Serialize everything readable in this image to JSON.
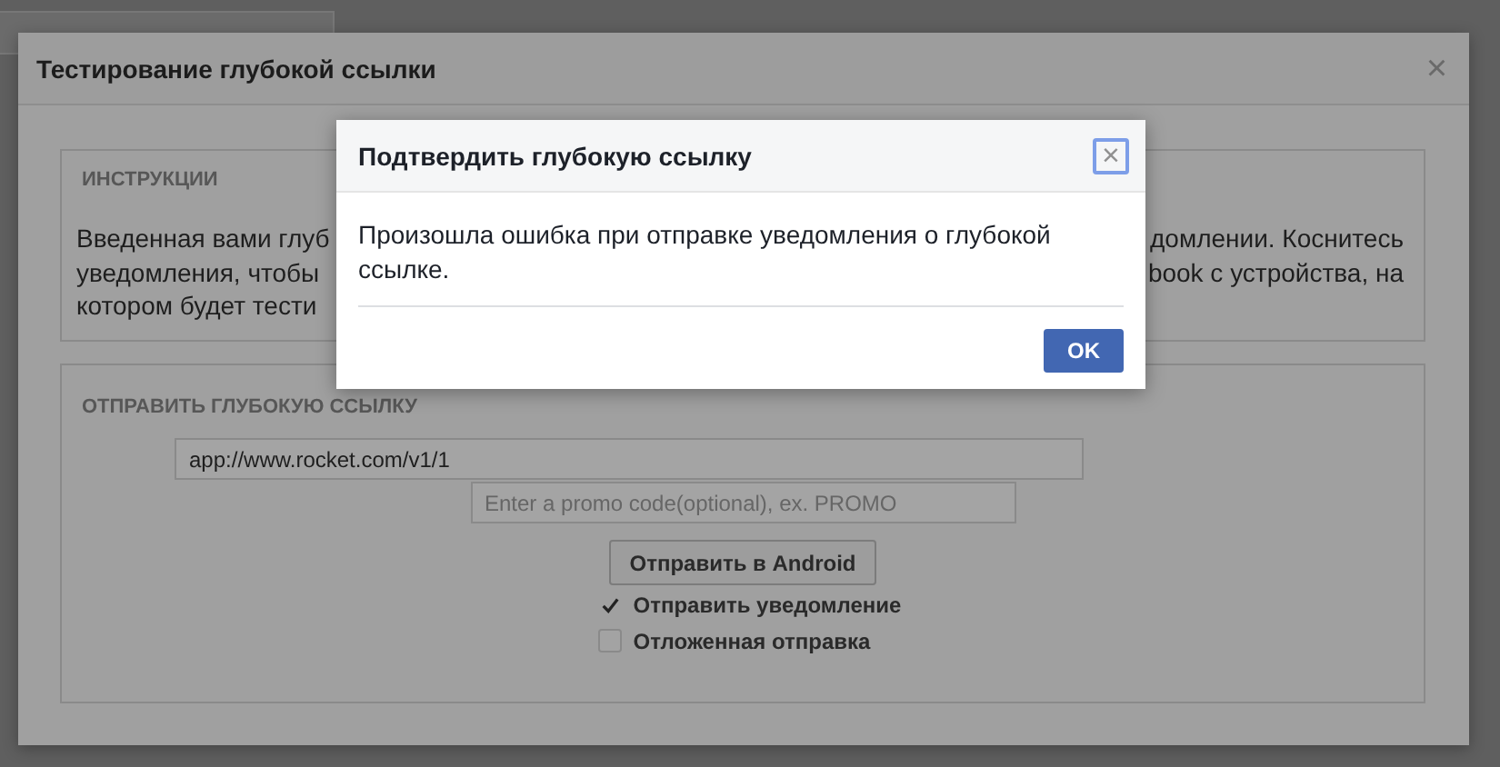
{
  "modal": {
    "title": "Тестирование глубокой ссылки",
    "close": "×",
    "instructions": {
      "heading": "ИНСТРУКЦИИ",
      "lines": [
        {
          "left": "Введенная вами глуб",
          "right": "домлении. Коснитесь"
        },
        {
          "left": "уведомления, чтобы",
          "right": "book с устройства, на"
        },
        {
          "left": "котором будет тести"
        }
      ]
    },
    "send": {
      "heading": "ОТПРАВИТЬ ГЛУБОКУЮ ССЫЛКУ",
      "url_field": {
        "value": "app://www.rocket.com/v1/1"
      },
      "promo_field": {
        "placeholder": "Enter a promo code(optional), ex. PROMO"
      },
      "send_button": "Отправить в Android",
      "options": [
        {
          "label": "Отправить уведомление",
          "checked": true
        },
        {
          "label": "Отложенная отправка",
          "checked": false
        }
      ]
    }
  },
  "alert": {
    "title": "Подтвердить глубокую ссылку",
    "close": "×",
    "message": "Произошла ошибка при отправке уведомления о глубокой ссылке.",
    "ok_button": "OK"
  }
}
